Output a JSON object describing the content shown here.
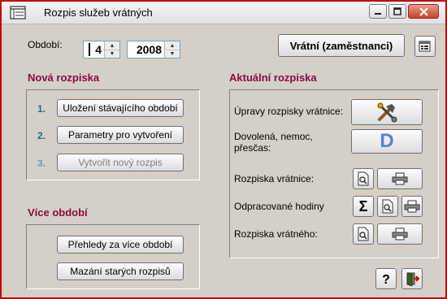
{
  "window": {
    "title": "Rozpis služeb vrátných"
  },
  "period": {
    "label": "Období:",
    "month": "4",
    "year": "2008"
  },
  "top": {
    "staff_button": "Vrátní (zaměstnanci)"
  },
  "new_schedule": {
    "heading": "Nová rozpiska",
    "steps": [
      {
        "num": "1.",
        "label": "Uložení stávajícího období"
      },
      {
        "num": "2.",
        "label": "Parametry pro vytvoření"
      },
      {
        "num": "3.",
        "label": "Vytvořit nový rozpis"
      }
    ]
  },
  "multi_period": {
    "heading": "Více období",
    "overview_button": "Přehledy za více období",
    "delete_button": "Mazání starých rozpisů"
  },
  "current_schedule": {
    "heading": "Aktuální rozpiska",
    "rows": {
      "edit": "Úpravy rozpisky vrátnice:",
      "leave_line1": "Dovolená, nemoc,",
      "leave_line2": "přesčas:",
      "reception": "Rozpiska vrátnice:",
      "hours": "Odpracované hodiny",
      "porter": "Rozpiska vrátného:"
    },
    "d_letter": "D",
    "sigma": "Σ"
  },
  "icons": {
    "app": "form-icon",
    "minimize": "minimize-icon",
    "maximize": "maximize-icon",
    "close": "close-icon",
    "settings": "properties-icon",
    "tools": "tools-icon",
    "preview": "print-preview-icon",
    "print": "printer-icon",
    "help": "help-icon",
    "exit": "exit-door-icon"
  },
  "colors": {
    "section_heading": "#8b0a3c",
    "step_number": "#1a6d84",
    "d_letter": "#5b7fd8",
    "close_button": "#c9432a"
  }
}
